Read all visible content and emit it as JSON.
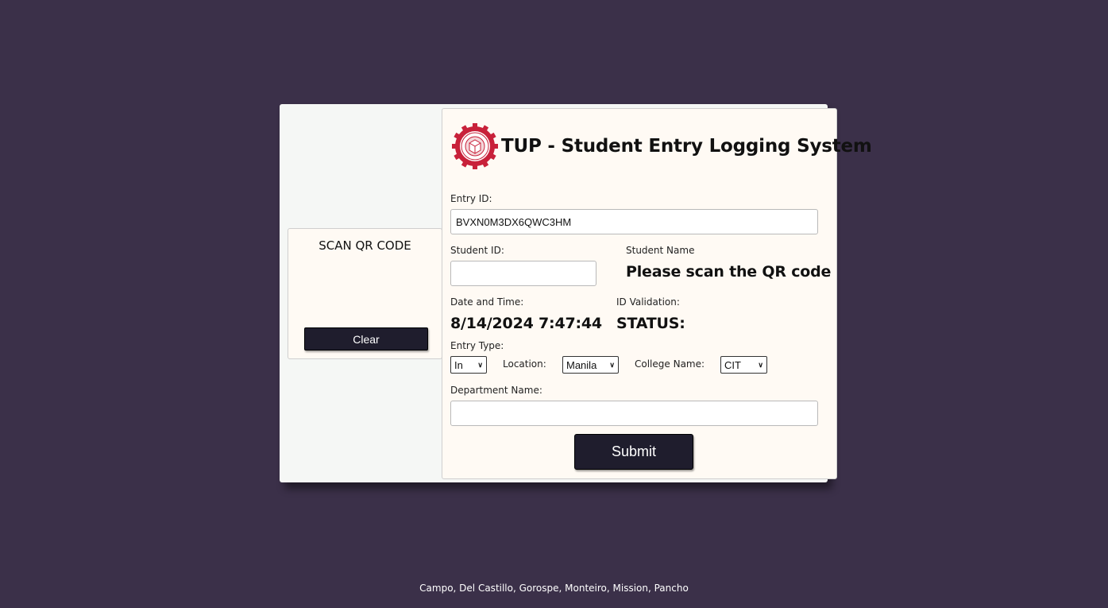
{
  "scan": {
    "title": "SCAN QR CODE",
    "clear_label": "Clear"
  },
  "form": {
    "title": "TUP - Student Entry Logging System",
    "logo_icon": "tup-seal-logo",
    "entry_id_label": "Entry ID:",
    "entry_id_value": "BVXN0M3DX6QWC3HM",
    "student_id_label": "Student ID:",
    "student_id_value": "",
    "student_name_label": "Student Name",
    "student_name_value": "Please scan the QR code",
    "datetime_label": "Date and Time:",
    "datetime_value": "8/14/2024 7:47:44",
    "validation_label": "ID Validation:",
    "validation_value": "STATUS:",
    "entry_type_label": "Entry Type:",
    "entry_type_value": "In",
    "location_label": "Location:",
    "location_value": "Manila",
    "college_label": "College Name:",
    "college_value": "CIT",
    "department_label": "Department Name:",
    "department_value": "",
    "submit_label": "Submit"
  },
  "footer": {
    "credits": "Campo, Del Castillo, Gorospe, Monteiro, Mission, Pancho"
  },
  "colors": {
    "background": "#3b3049",
    "button": "#1f1d2d",
    "logo_red": "#c8213a"
  }
}
